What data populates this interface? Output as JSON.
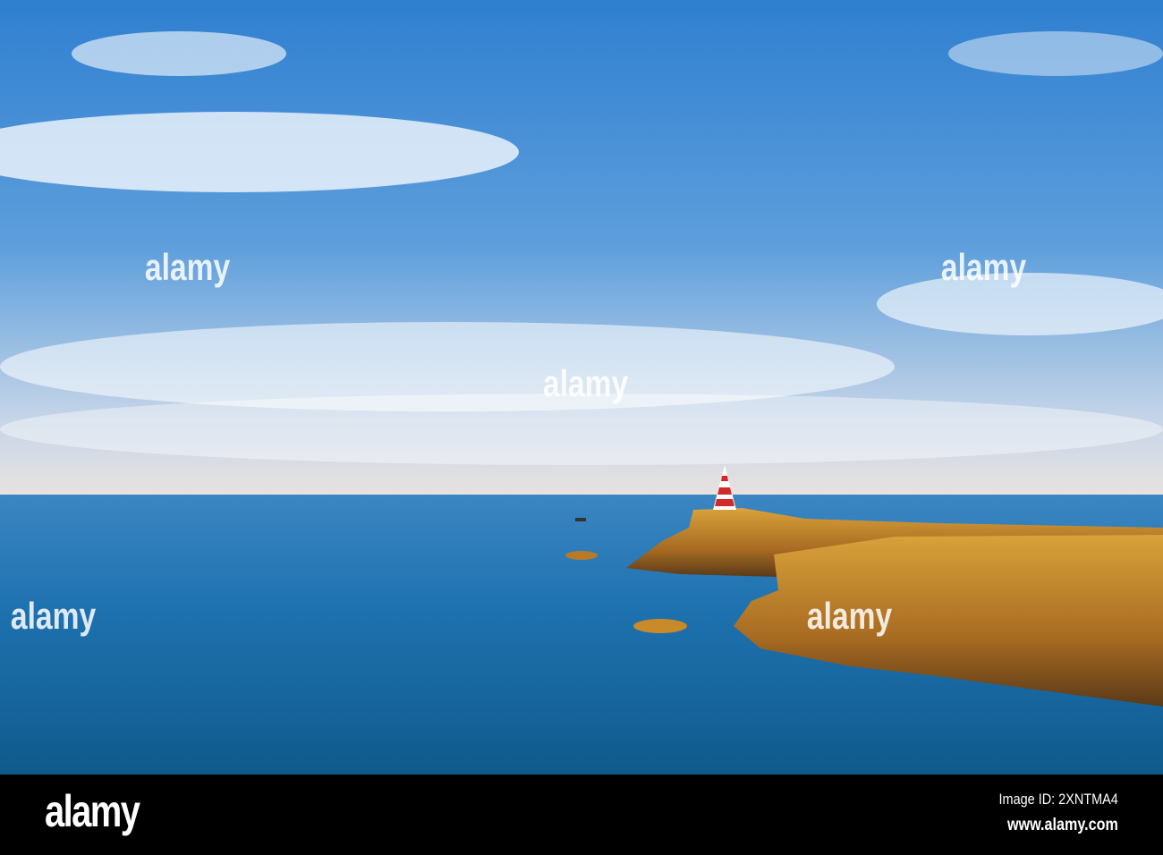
{
  "footer": {
    "logo": "alamy",
    "image_id": "Image ID: 2XNTMA4",
    "url": "www.alamy.com"
  },
  "watermark": "alamy",
  "colors": {
    "sky_top": "#2f7fd0",
    "sky_horizon": "#dfe4ec",
    "sea": "#1f6fa8",
    "cliff": "#c98a2a",
    "lighthouse_red": "#d22a2a"
  }
}
